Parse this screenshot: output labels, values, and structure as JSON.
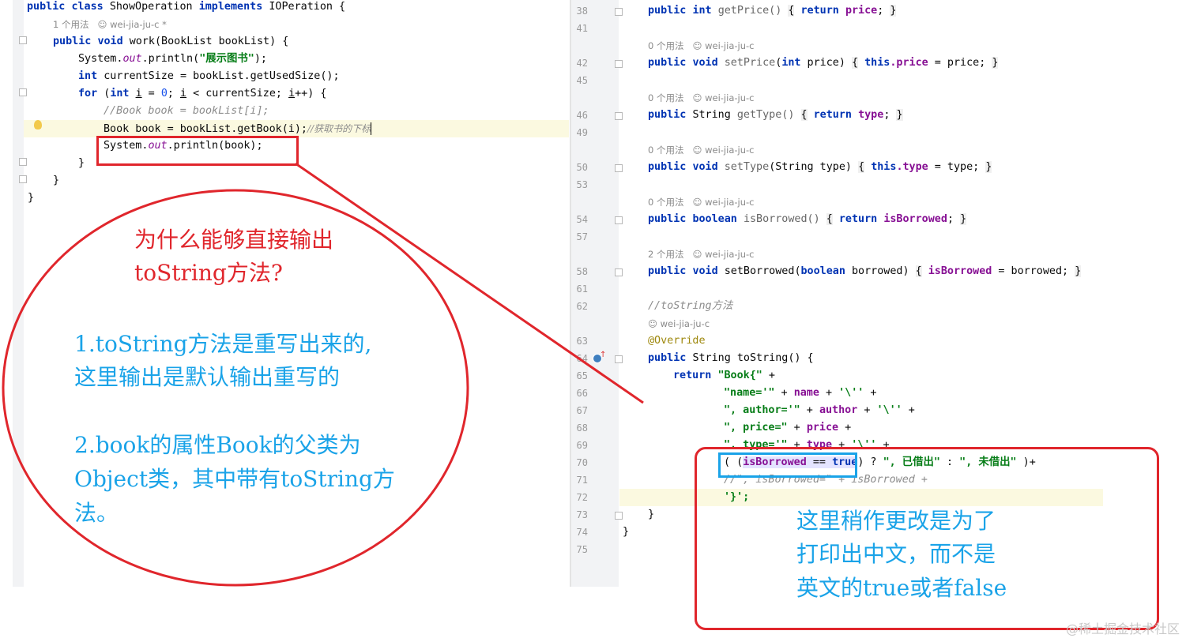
{
  "left_editor": {
    "class_decl": {
      "kw1": "public",
      "kw2": "class",
      "name": "ShowOperation",
      "kw3": "implements",
      "iface": "IOPeration {"
    },
    "usage_hint": {
      "count": "1 个用法",
      "author": "wei-jia-ju-c *"
    },
    "method_decl": {
      "kw1": "public",
      "kw2": "void",
      "rest": "work(BookList bookList) {"
    },
    "line_println1": {
      "pre": "System.",
      "out": "out",
      "mid": ".println(",
      "str": "\"展示图书\"",
      "end": ");"
    },
    "line_size": {
      "kw": "int",
      "rest": "currentSize = bookList.getUsedSize();"
    },
    "line_for": {
      "kw1": "for",
      "paren": " (",
      "kw2": "int",
      "v1": "i",
      "eq": " = ",
      "zero": "0",
      "semi": "; ",
      "v2": "i",
      "lt": " < currentSize; ",
      "v3": "i",
      "inc": "++) {"
    },
    "line_comment": "//Book book = bookList[i];",
    "line_get": {
      "code": "Book book = bookList.getBook(i);",
      "comment": "//获取书的下标"
    },
    "line_println2": {
      "pre": "System.",
      "out": "out",
      "end": ".println(book);"
    },
    "close1": "}",
    "close2": "}",
    "close3": "}"
  },
  "right_editor": {
    "lines": [
      {
        "num": "38",
        "html_kw": [
          "public",
          "int"
        ],
        "text": "getPrice() { return price; }"
      },
      {
        "num": "41"
      },
      {
        "num": "42",
        "text": "setPrice"
      },
      {
        "num": "45"
      },
      {
        "num": "46"
      },
      {
        "num": "49"
      },
      {
        "num": "50"
      },
      {
        "num": "53"
      },
      {
        "num": "54"
      },
      {
        "num": "57"
      },
      {
        "num": "58"
      },
      {
        "num": "61"
      },
      {
        "num": "62"
      },
      {
        "num": "63"
      },
      {
        "num": "64"
      },
      {
        "num": "65"
      },
      {
        "num": "66"
      },
      {
        "num": "67"
      },
      {
        "num": "68"
      },
      {
        "num": "69"
      },
      {
        "num": "70"
      },
      {
        "num": "71"
      },
      {
        "num": "72"
      },
      {
        "num": "73"
      },
      {
        "num": "74"
      },
      {
        "num": "75"
      }
    ],
    "hints": {
      "h42": {
        "count": "0 个用法",
        "author": "wei-jia-ju-c"
      },
      "h46": {
        "count": "0 个用法",
        "author": "wei-jia-ju-c"
      },
      "h50": {
        "count": "0 个用法",
        "author": "wei-jia-ju-c"
      },
      "h54": {
        "count": "0 个用法",
        "author": "wei-jia-ju-c"
      },
      "h58": {
        "count": "2 个用法",
        "author": "wei-jia-ju-c"
      },
      "h63": {
        "author": "wei-jia-ju-c"
      }
    },
    "code": {
      "l38": {
        "kw1": "public",
        "kw2": "int",
        "name": "getPrice()",
        "ob": "{",
        "kw3": "return",
        "fld": "price",
        "end": ";",
        "cb": "}"
      },
      "l42": {
        "kw1": "public",
        "kw2": "void",
        "name": "setPrice",
        "params": "(",
        "kw3": "int",
        "p": " price)",
        "ob": "{",
        "kw4": "this",
        "fld": ".price",
        "eq": " = price;",
        "cb": "}"
      },
      "l46": {
        "kw1": "public",
        "t": "String",
        "name": "getType()",
        "ob": "{",
        "kw3": "return",
        "fld": "type",
        "end": ";",
        "cb": "}"
      },
      "l50": {
        "kw1": "public",
        "kw2": "void",
        "name": "setType",
        "p": "(String type)",
        "ob": "{",
        "kw4": "this",
        "fld": ".type",
        "eq": " = type;",
        "cb": "}"
      },
      "l54": {
        "kw1": "public",
        "kw2": "boolean",
        "name": "isBorrowed()",
        "ob": "{",
        "kw3": "return",
        "fld": "isBorrowed",
        "end": ";",
        "cb": "}"
      },
      "l58": {
        "kw1": "public",
        "kw2": "void",
        "name": "setBorrowed",
        "paren": "(",
        "kw3": "boolean",
        "p": " borrowed)",
        "ob": "{",
        "fld": "isBorrowed",
        "eq": " = borrowed;",
        "cb": "}"
      },
      "l62": "//toString方法",
      "l63": "@Override",
      "l64": {
        "kw1": "public",
        "rest": "String toString() {"
      },
      "l65": {
        "kw": "return",
        "str": "\"Book{\"",
        "plus": " +"
      },
      "l66": {
        "str": "\"name='\"",
        "mid": " + ",
        "fld": "name",
        "mid2": " + ",
        "str2": "'\\''",
        "plus": " +"
      },
      "l67": {
        "str": "\", author='\"",
        "mid": " + ",
        "fld": "author",
        "mid2": " + ",
        "str2": "'\\''",
        "plus": " +"
      },
      "l68": {
        "str": "\", price=\"",
        "mid": " + ",
        "fld": "price",
        "plus": " +"
      },
      "l69": {
        "str": "\", type='\"",
        "mid": " + ",
        "fld": "type",
        "mid2": " + ",
        "str2": "'\\''",
        "plus": " +"
      },
      "l70": {
        "open": "( (",
        "fld": "isBorrowed",
        "op": " == ",
        "kw": "true",
        "close": ") ? ",
        "str1": "\", 已借出\"",
        "colon": " : ",
        "str2": "\", 未借出\"",
        "end": " )+"
      },
      "l71": "//\", isBorrowed=\" + isBorrowed +",
      "l72": "'}';",
      "l73": "}",
      "l74": "}"
    }
  },
  "annotations": {
    "question_line1": "为什么能够直接输出",
    "question_line2": "toString方法?",
    "answer1_line1": "1.toString方法是重写出来的,",
    "answer1_line2": "这里输出是默认输出重写的",
    "answer2_line1": "2.book的属性Book的父类为",
    "answer2_line2": "Object类，其中带有toString方",
    "answer2_line3": "法。",
    "change_line1": "这里稍作更改是为了",
    "change_line2": "打印出中文，而不是",
    "change_line3": "英文的true或者false",
    "red_color": "#e0262c",
    "blue_color": "#1aa3e8"
  },
  "watermark": "@稀土掘金技术社区"
}
